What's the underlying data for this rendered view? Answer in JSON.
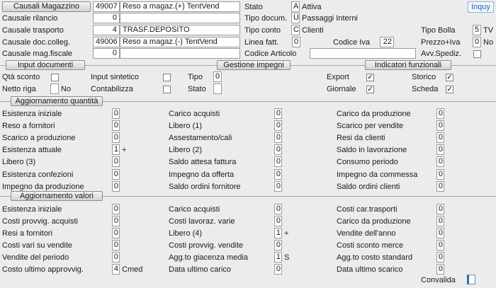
{
  "top_button": "Causali Magazzino",
  "inquiry_button": "Inquy",
  "header_left": [
    {
      "label": "Causale rilancio",
      "code": "0",
      "desc": ""
    },
    {
      "label": "Causale trasporto",
      "code": "4",
      "desc": "TRASF.DEPOSITO"
    },
    {
      "label": "Causale doc.colleg.",
      "code": "49006",
      "desc": "Reso a magaz.(-) TentVend"
    },
    {
      "label": "Causale mag.fiscale",
      "code": "0",
      "desc": ""
    }
  ],
  "main": {
    "code": "49007",
    "desc": "Reso a magaz.(+) TentVend"
  },
  "header_mid": {
    "stato_label": "Stato",
    "stato_code": "A",
    "stato_desc": "Attiva",
    "tipo_doc_label": "Tipo docum.",
    "tipo_doc_code": "U",
    "tipo_doc_desc": "Passaggi Interni",
    "tipo_conto_label": "Tipo conto",
    "tipo_conto_code": "C",
    "tipo_conto_desc": "Clienti",
    "linea_fatt_label": "Linea fatt.",
    "linea_fatt_value": "0",
    "codice_iva_label": "Codice Iva",
    "codice_iva_value": "22",
    "codice_articolo_label": "Codice Articolo",
    "codice_articolo_value": ""
  },
  "header_right": {
    "tipo_bolla_label": "Tipo Bolla",
    "tipo_bolla_value": "5",
    "tipo_bolla_desc": "TV",
    "prezzo_iva_label": "Prezzo+Iva",
    "prezzo_iva_value": "0",
    "prezzo_iva_desc": "No",
    "avv_spediz_label": "Avv.Spediz."
  },
  "sections": {
    "input_documenti": "Input documenti",
    "gestione_impegni": "Gestione impegni",
    "indicatori_funzionali": "Indicatori funzionali",
    "aggiornamento_quantita": "Aggiornamento quantità",
    "aggiornamento_valori": "Aggiornamento valori"
  },
  "input_documenti": {
    "qta_sconto": "Qtà sconto",
    "netto_riga": "Netto riga",
    "netto_riga_value": "No",
    "input_sintetico": "Input sintetico",
    "contabilizza": "Contabilizza"
  },
  "gestione_impegni": {
    "tipo_label": "Tipo",
    "tipo_value": "0",
    "stato_label": "Stato"
  },
  "indicatori": {
    "export": "Export",
    "giornale": "Giornale",
    "storico": "Storico",
    "scheda": "Scheda",
    "check_mark": "✓"
  },
  "quantita": {
    "col1": [
      {
        "label": "Esistenza iniziale",
        "value": "0",
        "suffix": ""
      },
      {
        "label": "Reso    a fornitori",
        "value": "0",
        "suffix": ""
      },
      {
        "label": "Scarico a produzione",
        "value": "0",
        "suffix": ""
      },
      {
        "label": "Esistenza attuale",
        "value": "1",
        "suffix": "+"
      },
      {
        "label": "Libero (3)",
        "value": "0",
        "suffix": ""
      },
      {
        "label": "Esistenza confezioni",
        "value": "0",
        "suffix": ""
      },
      {
        "label": "Impegno da produzione",
        "value": "0",
        "suffix": ""
      }
    ],
    "col2": [
      {
        "label": "Carico acquisti",
        "value": "0"
      },
      {
        "label": "Libero (1)",
        "value": "0"
      },
      {
        "label": "Assestamento/cali",
        "value": "0"
      },
      {
        "label": "Libero (2)",
        "value": "0"
      },
      {
        "label": "Saldo attesa fattura",
        "value": "0"
      },
      {
        "label": "Impegno da offerta",
        "value": "0"
      },
      {
        "label": "Saldo ordini fornitore",
        "value": "0"
      }
    ],
    "col3": [
      {
        "label": "Carico da produzione",
        "value": "0"
      },
      {
        "label": "Scarico per vendite",
        "value": "0"
      },
      {
        "label": "Resi  da clienti",
        "value": "0"
      },
      {
        "label": "Saldo in lavorazione",
        "value": "0"
      },
      {
        "label": "Consumo periodo",
        "value": "0"
      },
      {
        "label": "Impegno da commessa",
        "value": "0"
      },
      {
        "label": "Saldo ordini clienti",
        "value": "0"
      }
    ]
  },
  "valori": {
    "col1": [
      {
        "label": "Esistenza iniziale",
        "value": "0",
        "suffix": ""
      },
      {
        "label": "Costi provvig. acquisti",
        "value": "0",
        "suffix": ""
      },
      {
        "label": "Resi a fornitori",
        "value": "0",
        "suffix": ""
      },
      {
        "label": "Costi vari su vendite",
        "value": "0",
        "suffix": ""
      },
      {
        "label": "Vendite del periodo",
        "value": "0",
        "suffix": ""
      },
      {
        "label": "Costo ultimo approvvig.",
        "value": "4",
        "suffix": "Cmed"
      }
    ],
    "col2": [
      {
        "label": "Carico acquisti",
        "value": "0",
        "suffix": ""
      },
      {
        "label": "Costi lavoraz. varie",
        "value": "0",
        "suffix": ""
      },
      {
        "label": "Libero (4)",
        "value": "1",
        "suffix": "+"
      },
      {
        "label": "Costi provvig. vendite",
        "value": "0",
        "suffix": ""
      },
      {
        "label": "Agg.to giacenza media",
        "value": "1",
        "suffix": "S"
      },
      {
        "label": "Data ultimo carico",
        "value": "0",
        "suffix": ""
      }
    ],
    "col3": [
      {
        "label": "Costi  car.trasporti",
        "value": "0"
      },
      {
        "label": "Carico da produzione",
        "value": "0"
      },
      {
        "label": "Vendite dell'anno",
        "value": "0"
      },
      {
        "label": "Costi sconto merce",
        "value": "0"
      },
      {
        "label": "Agg.to costo standard",
        "value": "0"
      },
      {
        "label": "Data ultimo scarico",
        "value": "0"
      }
    ]
  },
  "footer": {
    "convalida": "Convalida"
  }
}
